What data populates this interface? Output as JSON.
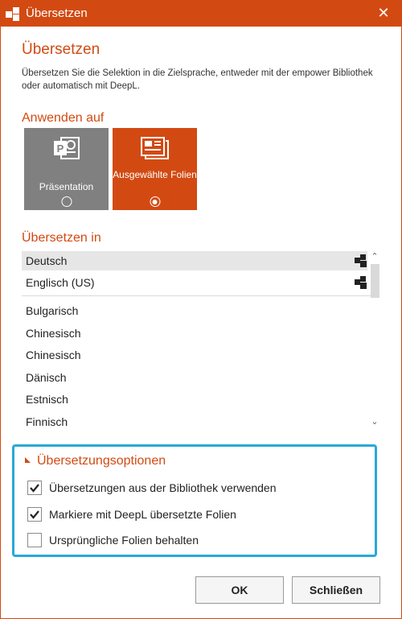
{
  "window": {
    "title": "Übersetzen",
    "close_symbol": "✕"
  },
  "heading": "Übersetzen",
  "description": "Übersetzen Sie die Selektion in die Zielsprache, entweder mit der empower Bibliothek oder automatisch mit DeepL.",
  "apply_to": {
    "label": "Anwenden auf",
    "options": [
      {
        "label": "Präsentation",
        "icon": "powerpoint-icon",
        "selected": false
      },
      {
        "label": "Ausgewählte Folien",
        "icon": "slides-icon",
        "selected": true
      }
    ]
  },
  "translate_to": {
    "label": "Übersetzen in",
    "favorites": [
      {
        "label": "Deutsch",
        "selected": true,
        "icon": "deepl-icon"
      },
      {
        "label": "Englisch (US)",
        "selected": false,
        "icon": "deepl-icon"
      }
    ],
    "languages": [
      "Bulgarisch",
      "Chinesisch",
      "Chinesisch",
      "Dänisch",
      "Estnisch",
      "Finnisch"
    ]
  },
  "options": {
    "header": "Übersetzungsoptionen",
    "items": [
      {
        "label": "Übersetzungen aus der Bibliothek verwenden",
        "checked": true
      },
      {
        "label": "Markiere mit DeepL übersetzte Folien",
        "checked": true
      },
      {
        "label": "Ursprüngliche Folien behalten",
        "checked": false
      }
    ]
  },
  "buttons": {
    "ok": "OK",
    "close": "Schließen"
  },
  "colors": {
    "accent": "#d24a12",
    "highlight_border": "#29a9d6",
    "tile_inactive": "#808080"
  }
}
